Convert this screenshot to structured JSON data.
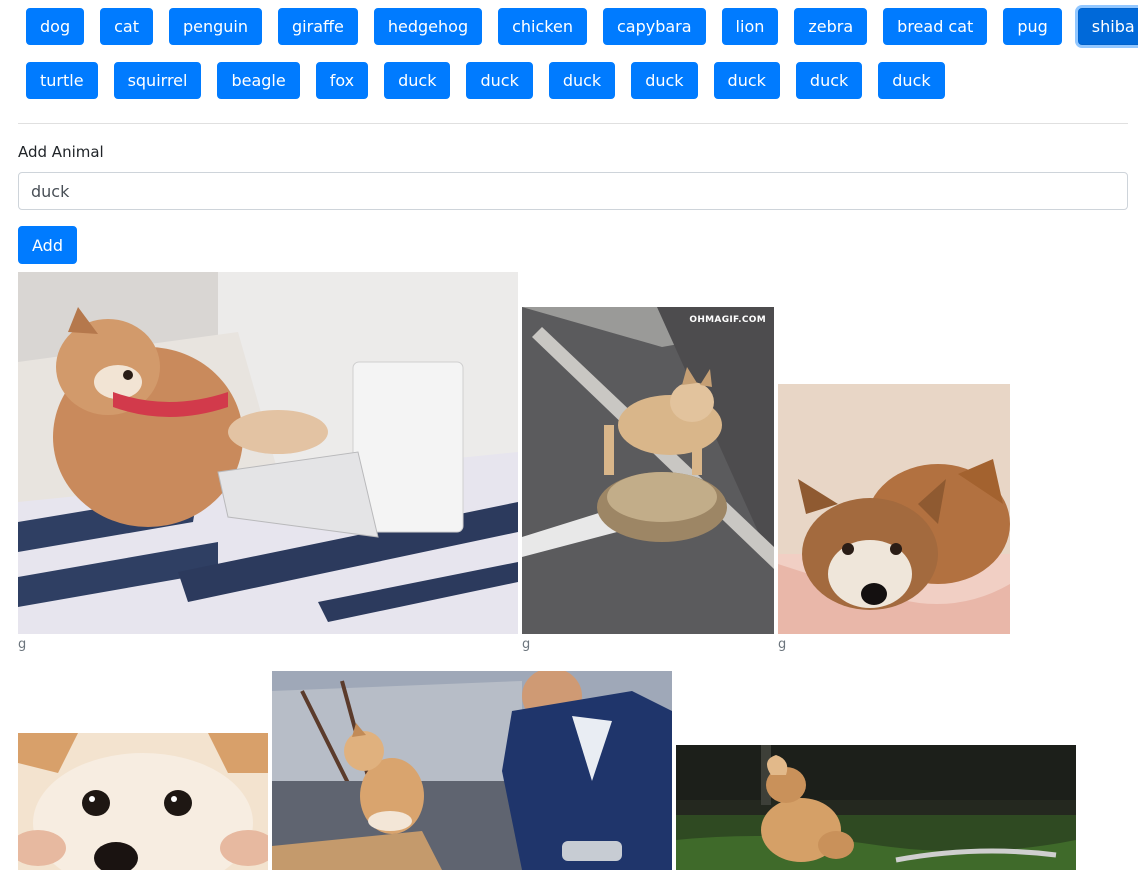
{
  "animal_buttons_row1": [
    "dog",
    "cat",
    "penguin",
    "giraffe",
    "hedgehog",
    "chicken",
    "capybara",
    "lion",
    "zebra",
    "bread cat",
    "pug",
    "shiba inu"
  ],
  "animal_buttons_row2": [
    "turtle",
    "squirrel",
    "beagle",
    "fox",
    "duck",
    "duck",
    "duck",
    "duck",
    "duck",
    "duck",
    "duck"
  ],
  "active_button": "shiba inu",
  "form": {
    "label": "Add Animal",
    "input_value": "duck",
    "add_button": "Add"
  },
  "gifs": [
    {
      "caption": "g",
      "subject": "shiba-on-laptop"
    },
    {
      "caption": "g",
      "subject": "shiba-riding-tortoise",
      "watermark": "OHMAGIF.COM"
    },
    {
      "caption": "g",
      "subject": "shiba-with-plush"
    },
    {
      "caption": "",
      "subject": "shiba-face-closeup"
    },
    {
      "caption": "",
      "subject": "shiba-with-boy"
    },
    {
      "caption": "",
      "subject": "shiba-sniffing-grass"
    }
  ],
  "colors": {
    "primary": "#007bff",
    "text": "#212529",
    "muted": "#6c757d"
  }
}
